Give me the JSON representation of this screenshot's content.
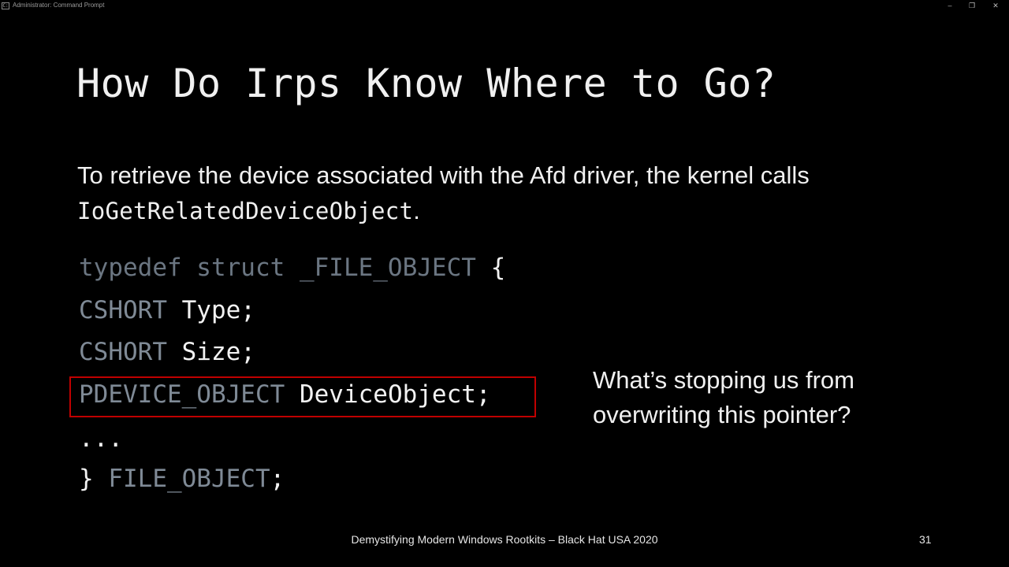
{
  "window": {
    "title": "Administrator: Command Prompt",
    "app_icon": "cmd-icon",
    "controls": [
      "minimize-icon",
      "restore-icon",
      "close-icon"
    ]
  },
  "slide": {
    "title": "How Do Irps Know Where to Go?",
    "body_prefix": "To retrieve the device associated with the Afd driver, the kernel calls ",
    "body_function": "IoGetRelatedDeviceObject",
    "body_suffix": ".",
    "code": {
      "line1_keyword": "typedef struct _FILE_OBJECT",
      "line1_brace": " {",
      "line2_type": "CSHORT",
      "line2_field": " Type;",
      "line3_type": "CSHORT",
      "line3_field": " Size;",
      "line4_type": "PDEVICE_OBJECT",
      "line4_field": " DeviceObject;",
      "line5": "...",
      "line6_brace": "} ",
      "line6_type": "FILE_OBJECT",
      "line6_semi": ";"
    },
    "side_note_line1": "What’s stopping us from",
    "side_note_line2": "overwriting this pointer?",
    "footer": "Demystifying Modern Windows Rootkits – Black Hat USA 2020",
    "page_number": "31"
  },
  "colors": {
    "background": "#000000",
    "text": "#f0f0f0",
    "code_type": "#7f8a96",
    "highlight_border": "#c00000"
  }
}
